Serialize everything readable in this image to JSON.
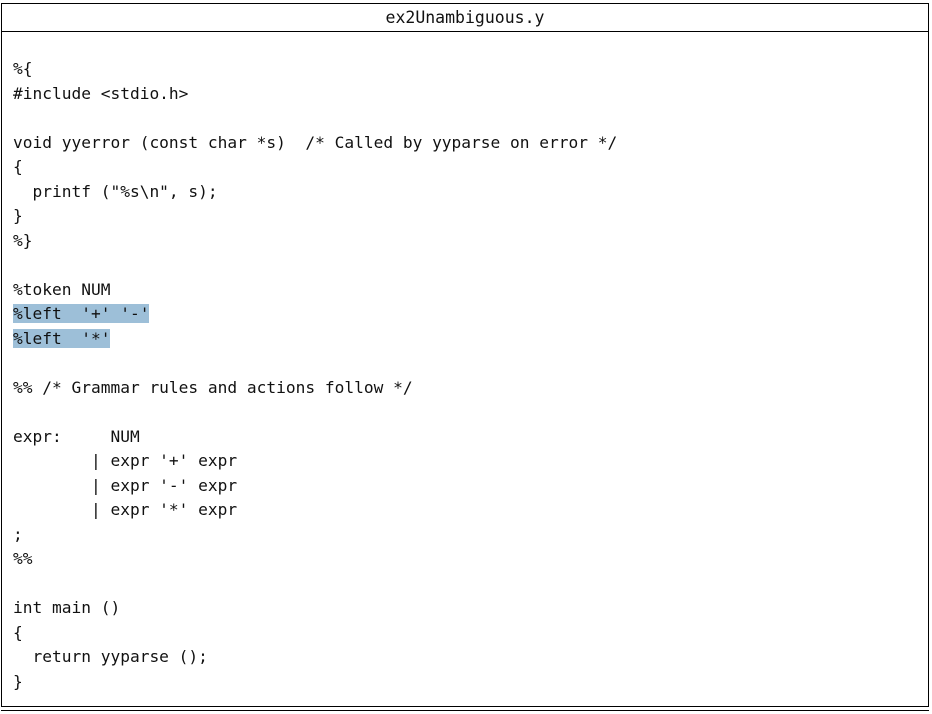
{
  "file": {
    "title": "ex2Unambiguous.y"
  },
  "code": {
    "lines": [
      {
        "text": "%{",
        "highlight": false
      },
      {
        "text": "#include <stdio.h>",
        "highlight": false
      },
      {
        "text": "",
        "highlight": false
      },
      {
        "text": "void yyerror (const char *s)  /* Called by yyparse on error */",
        "highlight": false
      },
      {
        "text": "{",
        "highlight": false
      },
      {
        "text": "  printf (\"%s\\n\", s);",
        "highlight": false
      },
      {
        "text": "}",
        "highlight": false
      },
      {
        "text": "%}",
        "highlight": false
      },
      {
        "text": "",
        "highlight": false
      },
      {
        "text": "%token NUM",
        "highlight": false
      },
      {
        "text": "%left  '+' '-'",
        "highlight": true
      },
      {
        "text": "%left  '*'",
        "highlight": true
      },
      {
        "text": "",
        "highlight": false
      },
      {
        "text": "%% /* Grammar rules and actions follow */",
        "highlight": false
      },
      {
        "text": "",
        "highlight": false
      },
      {
        "text": "expr:     NUM",
        "highlight": false
      },
      {
        "text": "        | expr '+' expr",
        "highlight": false
      },
      {
        "text": "        | expr '-' expr",
        "highlight": false
      },
      {
        "text": "        | expr '*' expr",
        "highlight": false
      },
      {
        "text": ";",
        "highlight": false
      },
      {
        "text": "%%",
        "highlight": false
      },
      {
        "text": "",
        "highlight": false
      },
      {
        "text": "int main ()",
        "highlight": false
      },
      {
        "text": "{",
        "highlight": false
      },
      {
        "text": "  return yyparse ();",
        "highlight": false
      },
      {
        "text": "}",
        "highlight": false
      }
    ],
    "highlight_color": "#9dbfd8"
  }
}
